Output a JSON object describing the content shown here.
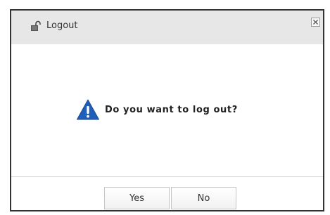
{
  "dialog": {
    "title": "Logout",
    "title_icon": "unlock-icon",
    "close_icon": "close-icon",
    "message": "Do you want to log out?",
    "message_icon": "warning-icon",
    "buttons": {
      "yes_label": "Yes",
      "no_label": "No"
    }
  },
  "colors": {
    "titlebar_bg": "#e7e7e7",
    "warning_blue": "#1f5fb8",
    "border": "#333333"
  }
}
